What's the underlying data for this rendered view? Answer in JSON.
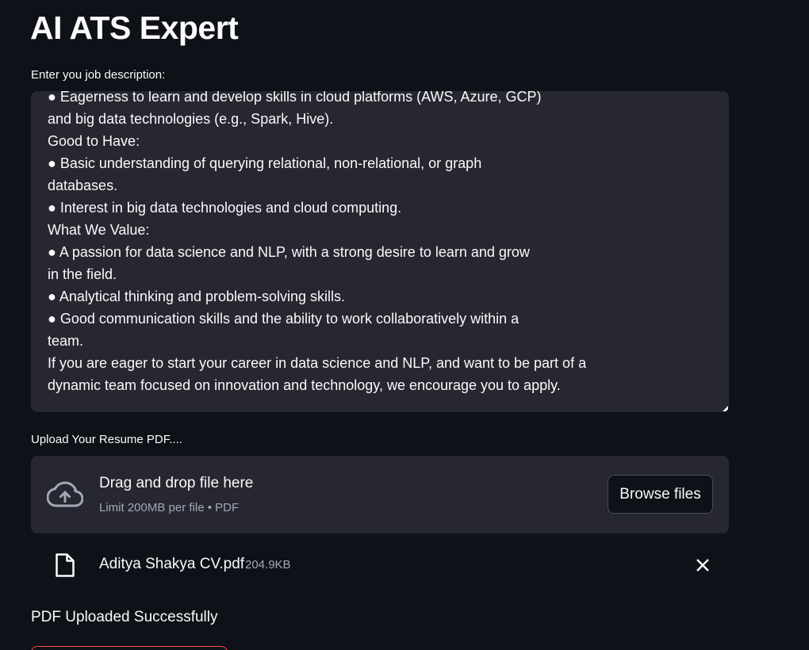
{
  "app": {
    "title": "AI ATS Expert"
  },
  "job_description": {
    "label": "Enter you job description:",
    "text": "● Eagerness to learn and develop skills in cloud platforms (AWS, Azure, GCP)\nand big data technologies (e.g., Spark, Hive).\nGood to Have:\n● Basic understanding of querying relational, non-relational, or graph\ndatabases.\n● Interest in big data technologies and cloud computing.\nWhat We Value:\n● A passion for data science and NLP, with a strong desire to learn and grow\nin the field.\n● Analytical thinking and problem-solving skills.\n● Good communication skills and the ability to work collaboratively within a\nteam.\nIf you are eager to start your career in data science and NLP, and want to be part of a\ndynamic team focused on innovation and technology, we encourage you to apply."
  },
  "upload": {
    "label": "Upload Your Resume PDF....",
    "dropzone_title": "Drag and drop file here",
    "dropzone_hint": "Limit 200MB per file • PDF",
    "browse_label": "Browse files",
    "icon": "cloud-upload-icon"
  },
  "uploaded_file": {
    "name": "Aditya Shakya CV.pdf",
    "size": "204.9KB",
    "icon": "file-icon"
  },
  "status": {
    "message": "PDF Uploaded Successfully"
  },
  "colors": {
    "background": "#0e1117",
    "surface": "#262730",
    "text": "#fafafa",
    "muted": "#a3a8b8",
    "accent": "#ff4b4b"
  }
}
